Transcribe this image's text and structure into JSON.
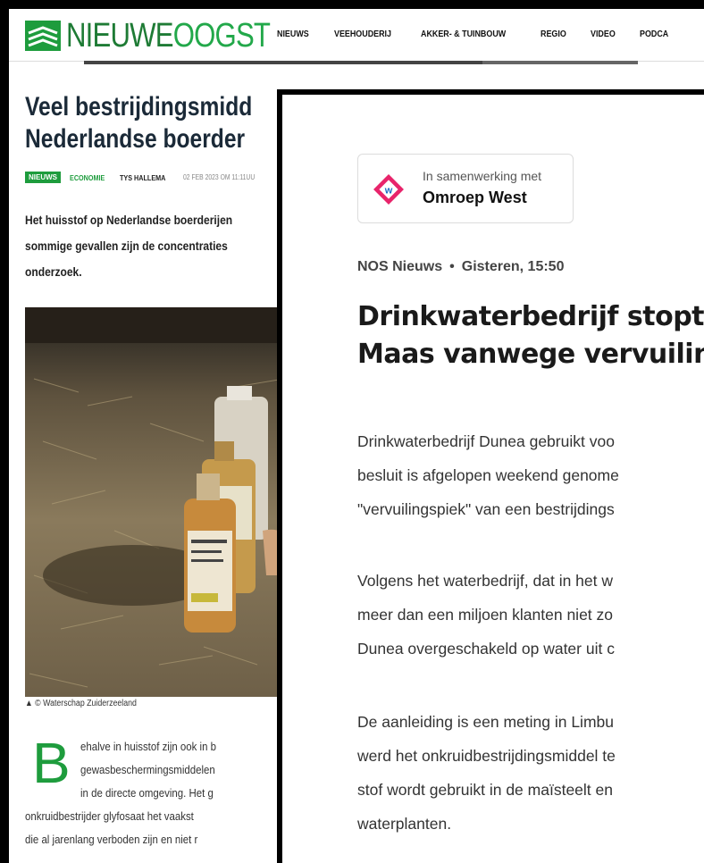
{
  "back": {
    "logo": {
      "part1": "NIEUWE",
      "part2": "OOGST"
    },
    "nav": [
      "NIEUWS",
      "VEEHOUDERIJ",
      "AKKER- & TUINBOUW",
      "REGIO",
      "VIDEO",
      "PODCA"
    ],
    "reading_progress": 0.72,
    "title_lines": [
      "Veel bestrijdingsmidd",
      "Nederlandse boerder"
    ],
    "meta": {
      "tag": "NIEUWS",
      "category": "ECONOMIE",
      "author": "TYS HALLEMA",
      "date": "02 FEB 2023 OM 11:11UU"
    },
    "intro_lines": [
      "Het huisstof op Nederlandse boerderijen",
      "sommige gevallen zijn de concentraties",
      "onderzoek."
    ],
    "caption": "▲  © Waterschap Zuiderzeeland",
    "dropcap": "B",
    "body_lines": [
      "ehalve in huisstof zijn ook in b",
      "gewasbeschermingsmiddelen",
      "in de directe omgeving. Het g",
      "onkruidbestrijder glyfosaat het vaakst",
      "die al jarenlang verboden zijn en niet r"
    ],
    "colors": {
      "brand_green": "#1e9c3d",
      "title": "#1b2a38"
    }
  },
  "front": {
    "partner": {
      "small": "In samenwerking met",
      "name": "Omroep West",
      "icon": "omroep-west-logo"
    },
    "source": {
      "outlet": "NOS Nieuws",
      "sep": "•",
      "time": "Gisteren, 15:50"
    },
    "title_lines": [
      "Drinkwaterbedrijf stopt",
      "Maas vanwege vervuilin"
    ],
    "paragraphs": [
      [
        "Drinkwaterbedrijf Dunea gebruikt voo",
        "besluit is afgelopen weekend genome",
        "\"vervuilingspiek\" van een bestrijdings"
      ],
      [
        "Volgens het waterbedrijf, dat in het w",
        "meer dan een miljoen klanten niet zo",
        "Dunea overgeschakeld op water uit c"
      ],
      [
        "De aanleiding is een meting in Limbu",
        "werd het onkruidbestrijdingsmiddel te",
        "stof wordt gebruikt in de maïsteelt en",
        "waterplanten."
      ]
    ]
  }
}
